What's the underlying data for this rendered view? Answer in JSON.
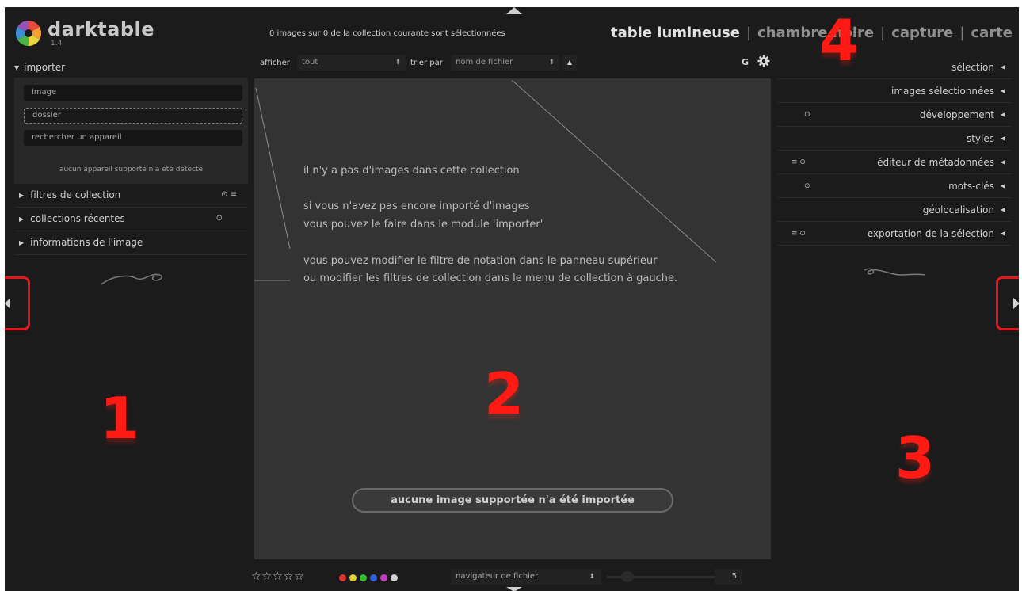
{
  "app": {
    "name": "darktable",
    "version": "1.4"
  },
  "header": {
    "selection_count_text": "0 images sur 0 de la collection courante sont sélectionnées",
    "views": {
      "lighttable": "table lumineuse",
      "darkroom": "chambre noire",
      "tethering": "capture",
      "map": "carte"
    },
    "separator": "|"
  },
  "filter_bar": {
    "show_label": "afficher",
    "show_value": "tout",
    "sort_label": "trier par",
    "sort_value": "nom de fichier",
    "sort_direction_icon": "triangle-up-icon",
    "grid_label": "G",
    "settings_icon": "gear-icon"
  },
  "left_panel": {
    "import_module": {
      "title": "importer",
      "buttons": [
        "image",
        "dossier",
        "rechercher un appareil"
      ],
      "note": "aucun appareil supporté n'a été détecté"
    },
    "modules": [
      {
        "label": "filtres de collection",
        "icons": "⊙ ≡"
      },
      {
        "label": "collections récentes",
        "icons": "⊙"
      },
      {
        "label": "informations de l'image",
        "icons": ""
      }
    ]
  },
  "center": {
    "message_lines": [
      "il n'y a pas d'images dans cette collection",
      "si vous n'avez pas encore importé d'images",
      "vous pouvez le faire dans le module 'importer'",
      "vous pouvez modifier le filtre de notation dans le panneau supérieur",
      "ou modifier les filtres de collection dans le menu de collection à gauche."
    ],
    "status_text": "aucune image supportée n'a été importée"
  },
  "right_panel": {
    "modules": [
      {
        "label": "sélection",
        "icons": ""
      },
      {
        "label": "images sélectionnées",
        "icons": ""
      },
      {
        "label": "développement",
        "icons": "⊙"
      },
      {
        "label": "styles",
        "icons": ""
      },
      {
        "label": "éditeur de métadonnées",
        "icons": "≡ ⊙"
      },
      {
        "label": "mots-clés",
        "icons": "⊙"
      },
      {
        "label": "géolocalisation",
        "icons": ""
      },
      {
        "label": "exportation de la sélection",
        "icons": "≡ ⊙"
      }
    ]
  },
  "annotations": {
    "n1": "1",
    "n2": "2",
    "n3": "3",
    "n4": "4"
  },
  "bottom_bar": {
    "stars": "☆☆☆☆☆",
    "color_labels": [
      "#e03030",
      "#e0d030",
      "#30c030",
      "#3060e0",
      "#c040c0",
      "#d0d0d0"
    ],
    "mode_value": "navigateur de fichier",
    "zoom_value": "5"
  },
  "colors": {
    "annotation": "#ff1a14",
    "background": "#1b1b1b",
    "center": "#333333"
  }
}
